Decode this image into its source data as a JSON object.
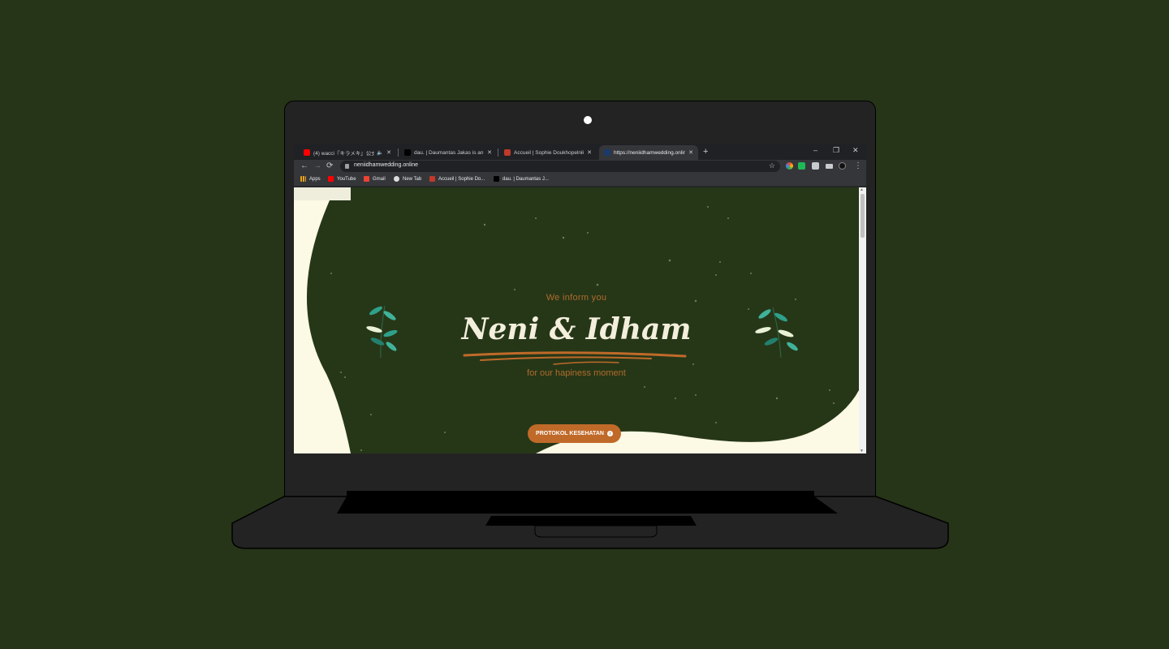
{
  "tabs": [
    {
      "title": "(4) wacci『キラメキ』公式とかりで",
      "favicon_color": "#ff0000"
    },
    {
      "title": "dau. | Daumantas Jakas is an awa",
      "favicon_color": "#000000"
    },
    {
      "title": "Accueil | Sophie Doukhopelnikoff",
      "favicon_color": "#c0392b"
    },
    {
      "title": "https://neniidhamwedding.online",
      "favicon_color": "#1a3a6b"
    }
  ],
  "window": {
    "minimize": "–",
    "restore": "❐",
    "close": "✕",
    "new_tab": "+"
  },
  "nav": {
    "back": "←",
    "forward": "→",
    "reload": "⟳",
    "star": "☆",
    "menu": "⋮"
  },
  "address": {
    "url": "neniidhamwedding.online"
  },
  "bookmarks": [
    {
      "label": "Apps",
      "favicon_color": "#e8a317"
    },
    {
      "label": "YouTube",
      "favicon_color": "#ff0000"
    },
    {
      "label": "Gmail",
      "favicon_color": "#ea4335"
    },
    {
      "label": "New Tab",
      "favicon_color": "#dddddd"
    },
    {
      "label": "Accueil | Sophie Do...",
      "favicon_color": "#c0392b"
    },
    {
      "label": "dau. | Daumantas J...",
      "favicon_color": "#000000"
    }
  ],
  "hero": {
    "subtitle_top": "We inform you",
    "names": "Neni & Idham",
    "subtitle_bottom": "for our hapiness moment",
    "cta_label": "PROTOKOL KESEHATAN",
    "cta_icon": "i"
  },
  "colors": {
    "desk_bg": "#263418",
    "page_bg": "#263718",
    "cream": "#fcf9e4",
    "accent": "#c06a29",
    "text_light": "#f3efdc"
  }
}
